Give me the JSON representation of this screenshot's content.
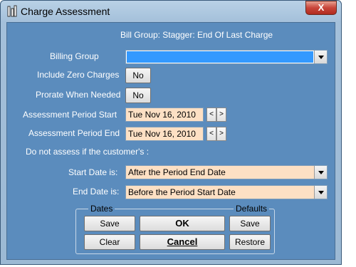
{
  "window": {
    "title": "Charge Assessment",
    "close_label": "X"
  },
  "header": {
    "bill_group_line": "Bill Group:  Stagger:  End Of Last Charge"
  },
  "form": {
    "billing_group_label": "Billing Group",
    "billing_group_value": "",
    "include_zero_label": "Include Zero Charges",
    "include_zero_value": "No",
    "prorate_label": "Prorate When Needed",
    "prorate_value": "No",
    "period_start_label": "Assessment Period Start",
    "period_start_value": "Tue Nov 16, 2010",
    "period_end_label": "Assessment Period End",
    "period_end_value": "Tue Nov 16, 2010",
    "spin_prev": "<",
    "spin_next": ">",
    "do_not_assess_label": "Do not assess if the customer's :",
    "start_date_label": "Start Date is:",
    "start_date_value": "After the Period End Date",
    "end_date_label": "End Date is:",
    "end_date_value": "Before the Period Start Date"
  },
  "buttons": {
    "dates_legend": "Dates",
    "defaults_legend": "Defaults",
    "dates_save": "Save",
    "dates_clear": "Clear",
    "ok": "OK",
    "cancel": "Cancel",
    "defaults_save": "Save",
    "defaults_restore": "Restore"
  },
  "colors": {
    "client_bg": "#5b8cbd",
    "field_peach": "#fde0c4",
    "selection_blue": "#3399ff"
  },
  "icons": {
    "title": "app-icon",
    "close": "close-icon",
    "dropdown": "chevron-down-icon"
  }
}
